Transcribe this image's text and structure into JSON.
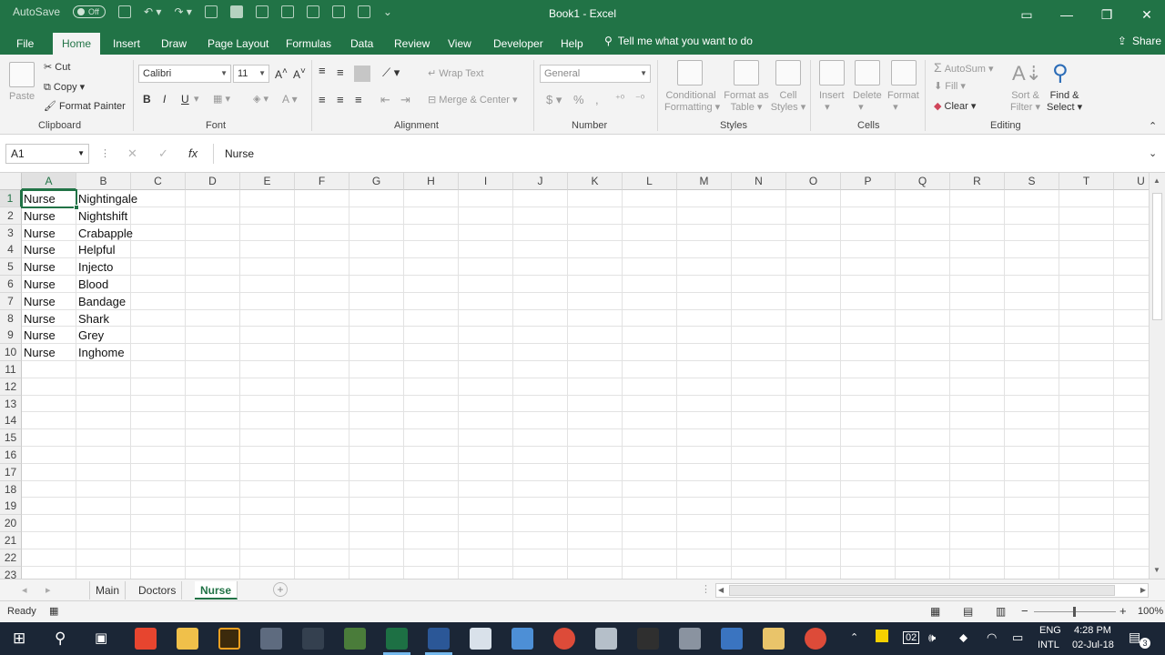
{
  "titlebar": {
    "autosave_label": "AutoSave",
    "autosave_state": "Off",
    "title": "Book1  -  Excel"
  },
  "ribbon_tabs": [
    "File",
    "Home",
    "Insert",
    "Draw",
    "Page Layout",
    "Formulas",
    "Data",
    "Review",
    "View",
    "Developer",
    "Help"
  ],
  "tell_me": "Tell me what you want to do",
  "share": "Share",
  "clipboard": {
    "paste": "Paste",
    "cut": "Cut",
    "copy": "Copy",
    "format_painter": "Format Painter",
    "label": "Clipboard"
  },
  "font": {
    "name": "Calibri",
    "size": "11",
    "bold": "B",
    "italic": "I",
    "underline": "U",
    "label": "Font"
  },
  "alignment": {
    "wrap": "Wrap Text",
    "merge": "Merge & Center",
    "label": "Alignment"
  },
  "number": {
    "format": "General",
    "currency": "$",
    "percent": "%",
    "comma": ",",
    "label": "Number"
  },
  "styles": {
    "conditional": [
      "Conditional",
      "Formatting"
    ],
    "format_table": [
      "Format as",
      "Table"
    ],
    "cell_styles": [
      "Cell",
      "Styles"
    ],
    "label": "Styles"
  },
  "cells": {
    "insert": "Insert",
    "delete": "Delete",
    "format": "Format",
    "label": "Cells"
  },
  "editing": {
    "autosum": "AutoSum",
    "fill": "Fill",
    "clear": "Clear",
    "sort": [
      "Sort &",
      "Filter"
    ],
    "find": [
      "Find &",
      "Select"
    ],
    "label": "Editing"
  },
  "formula_bar": {
    "name_box": "A1",
    "fx": "fx",
    "value": "Nurse"
  },
  "columns": [
    "A",
    "B",
    "C",
    "D",
    "E",
    "F",
    "G",
    "H",
    "I",
    "J",
    "K",
    "L",
    "M",
    "N",
    "O",
    "P",
    "Q",
    "R",
    "S",
    "T",
    "U"
  ],
  "rows": [
    "1",
    "2",
    "3",
    "4",
    "5",
    "6",
    "7",
    "8",
    "9",
    "10",
    "11",
    "12",
    "13",
    "14",
    "15",
    "16",
    "17",
    "18",
    "19",
    "20",
    "21",
    "22",
    "23"
  ],
  "cells_data": [
    [
      "Nurse",
      "Nightingale"
    ],
    [
      "Nurse",
      "Nightshift"
    ],
    [
      "Nurse",
      "Crabapple"
    ],
    [
      "Nurse",
      "Helpful"
    ],
    [
      "Nurse",
      "Injecto"
    ],
    [
      "Nurse",
      "Blood"
    ],
    [
      "Nurse",
      "Bandage"
    ],
    [
      "Nurse",
      "Shark"
    ],
    [
      "Nurse",
      "Grey"
    ],
    [
      "Nurse",
      "Inghome"
    ]
  ],
  "sheets": [
    "Main",
    "Doctors",
    "Nurse"
  ],
  "active_sheet": "Nurse",
  "status": {
    "ready": "Ready",
    "zoom": "100%"
  },
  "tray": {
    "lang1": "ENG",
    "lang2": "INTL",
    "time": "4:28 PM",
    "date": "02-Jul-18",
    "notifications": "3",
    "badge": "02"
  },
  "colors": {
    "excel_green": "#217346",
    "taskbar": "#1b2636"
  }
}
